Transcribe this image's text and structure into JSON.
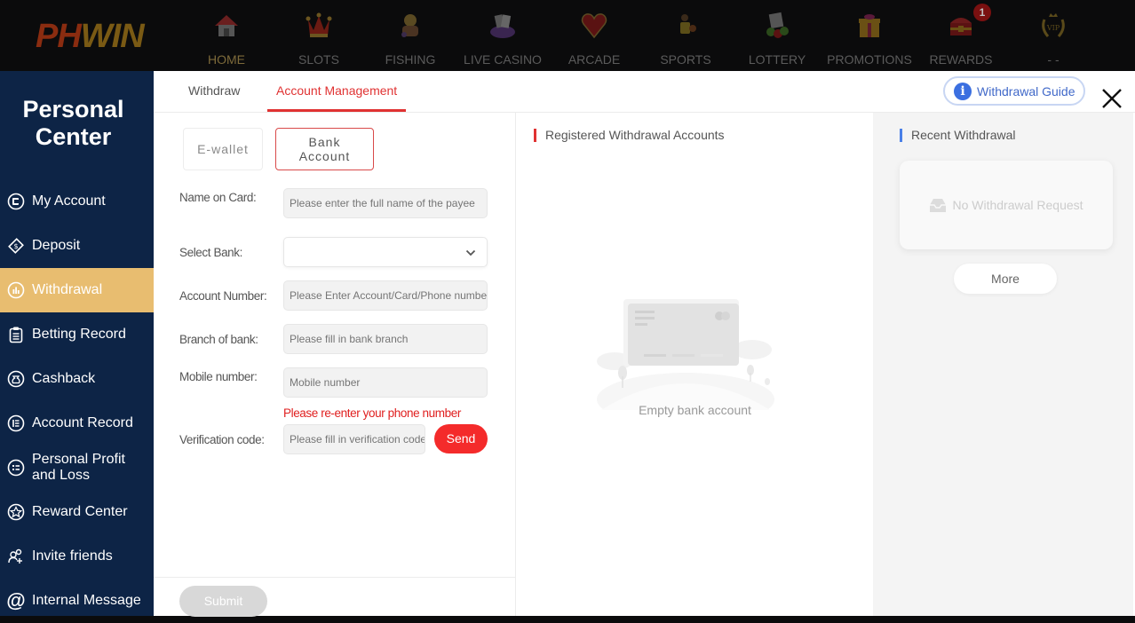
{
  "topnav": {
    "logo": {
      "part1": "PH",
      "part2": "WIN"
    },
    "items": [
      {
        "label": "HOME",
        "icon": "home-icon",
        "active": true
      },
      {
        "label": "SLOTS",
        "icon": "jester-crown-icon"
      },
      {
        "label": "FISHING",
        "icon": "fisherman-icon"
      },
      {
        "label": "LIVE CASINO",
        "icon": "cards-chips-icon"
      },
      {
        "label": "ARCADE",
        "icon": "heart-icon"
      },
      {
        "label": "SPORTS",
        "icon": "basketball-player-icon"
      },
      {
        "label": "LOTTERY",
        "icon": "lottery-balls-icon"
      },
      {
        "label": "PROMOTIONS",
        "icon": "gift-icon"
      },
      {
        "label": "REWARDS",
        "icon": "treasure-chest-icon",
        "badge": "1"
      },
      {
        "label": "- -",
        "icon": "vip-laurel-icon"
      }
    ],
    "vip_text": "VIP"
  },
  "sidebar": {
    "title_line1": "Personal",
    "title_line2": "Center",
    "items": [
      {
        "label": "My Account",
        "icon": "account-icon"
      },
      {
        "label": "Deposit",
        "icon": "deposit-icon"
      },
      {
        "label": "Withdrawal",
        "icon": "withdrawal-icon",
        "active": true
      },
      {
        "label": "Betting Record",
        "icon": "clipboard-icon"
      },
      {
        "label": "Cashback",
        "icon": "money-bag-icon"
      },
      {
        "label": "Account Record",
        "icon": "record-list-icon"
      },
      {
        "label": "Personal Profit and Loss",
        "icon": "profit-loss-icon"
      },
      {
        "label": "Reward Center",
        "icon": "star-icon"
      },
      {
        "label": "Invite friends",
        "icon": "invite-friends-icon"
      },
      {
        "label": "Internal Message",
        "icon": "at-icon"
      }
    ]
  },
  "tabs": [
    {
      "label": "Withdraw"
    },
    {
      "label": "Account Management",
      "active": true
    }
  ],
  "guide_button": "Withdrawal Guide",
  "guide_icon_glyph": "i",
  "account_types": {
    "ewallet": "E-wallet",
    "bank_line1": "Bank",
    "bank_line2": "Account"
  },
  "form": {
    "name_on_card": {
      "label": "Name on Card:",
      "placeholder": "Please enter the full name of the payee",
      "value": ""
    },
    "select_bank": {
      "label": "Select Bank:",
      "value": ""
    },
    "account_number": {
      "label": "Account Number:",
      "placeholder": "Please Enter Account/Card/Phone number",
      "value": ""
    },
    "branch": {
      "label": "Branch of bank:",
      "placeholder": "Please fill in bank branch",
      "value": ""
    },
    "mobile": {
      "label": "Mobile number:",
      "placeholder": "Mobile number",
      "value": ""
    },
    "mobile_error": "Please re-enter your phone number",
    "verification": {
      "label": "Verification code:",
      "placeholder": "Please fill in verification code",
      "value": ""
    },
    "send_label": "Send",
    "submit_label": "Submit"
  },
  "registered": {
    "title": "Registered Withdrawal Accounts",
    "empty_text": "Empty bank account"
  },
  "recent": {
    "title": "Recent Withdrawal",
    "empty_text": "No Withdrawal Request",
    "more_label": "More"
  },
  "colors": {
    "accent_red": "#e03232",
    "sidebar_bg": "#0d2446",
    "sidebar_active": "#e8bd70",
    "guide_blue": "#3b6fe0",
    "send_red": "#f42b2b"
  }
}
